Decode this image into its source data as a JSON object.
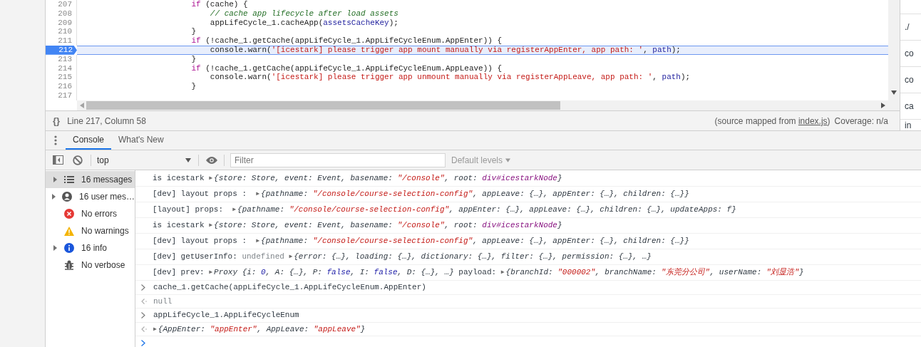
{
  "editor": {
    "lines": [
      {
        "number": "207",
        "selected": false,
        "tokens": [
          {
            "kind": "keyword",
            "text": "                        if"
          },
          {
            "kind": "plain",
            "text": " (cache) {"
          }
        ]
      },
      {
        "number": "208",
        "selected": false,
        "tokens": [
          {
            "kind": "comment",
            "text": "                            // cache app lifecycle after load assets"
          }
        ]
      },
      {
        "number": "209",
        "selected": false,
        "tokens": [
          {
            "kind": "plain",
            "text": "                            appLifeCycle_1.cacheApp("
          },
          {
            "kind": "variable",
            "text": "assetsCacheKey"
          },
          {
            "kind": "plain",
            "text": ");"
          }
        ]
      },
      {
        "number": "210",
        "selected": false,
        "tokens": [
          {
            "kind": "plain",
            "text": "                        }"
          }
        ]
      },
      {
        "number": "211",
        "selected": false,
        "tokens": [
          {
            "kind": "keyword",
            "text": "                        if"
          },
          {
            "kind": "plain",
            "text": " (!cache_1.getCache(appLifeCycle_1.AppLifeCycleEnum.AppEnter)) {"
          }
        ]
      },
      {
        "number": "212",
        "selected": true,
        "tokens": [
          {
            "kind": "plain",
            "text": "                            console.warn("
          },
          {
            "kind": "string",
            "text": "'[icestark] please trigger app mount manually via registerAppEnter, app path: '"
          },
          {
            "kind": "plain",
            "text": ", "
          },
          {
            "kind": "variable",
            "text": "path"
          },
          {
            "kind": "plain",
            "text": ");"
          }
        ]
      },
      {
        "number": "213",
        "selected": false,
        "tokens": [
          {
            "kind": "plain",
            "text": "                        }"
          }
        ]
      },
      {
        "number": "214",
        "selected": false,
        "tokens": [
          {
            "kind": "keyword",
            "text": "                        if"
          },
          {
            "kind": "plain",
            "text": " (!cache_1.getCache(appLifeCycle_1.AppLifeCycleEnum.AppLeave)) {"
          }
        ]
      },
      {
        "number": "215",
        "selected": false,
        "tokens": [
          {
            "kind": "plain",
            "text": "                            console.warn("
          },
          {
            "kind": "string",
            "text": "'[icestark] please trigger app unmount manually via registerAppLeave, app path: '"
          },
          {
            "kind": "plain",
            "text": ", "
          },
          {
            "kind": "variable",
            "text": "path"
          },
          {
            "kind": "plain",
            "text": ");"
          }
        ]
      },
      {
        "number": "216",
        "selected": false,
        "tokens": [
          {
            "kind": "plain",
            "text": "                        }"
          }
        ]
      },
      {
        "number": "217",
        "selected": false
      }
    ]
  },
  "right_panel": {
    "items": [
      "./",
      "co",
      "co",
      "ca",
      "in"
    ]
  },
  "status_bar": {
    "format_button": "{}",
    "cursor": "Line 217, Column 58",
    "source_prefix": "(source mapped from ",
    "source_link": "index.js",
    "source_suffix": ")",
    "coverage": "Coverage: n/a"
  },
  "drawer_tabs": [
    {
      "label": "Console",
      "selected": true
    },
    {
      "label": "What's New",
      "selected": false
    }
  ],
  "toolbar": {
    "context": "top",
    "filter_placeholder": "Filter",
    "levels": "Default levels"
  },
  "sidebar": {
    "items": [
      {
        "label": "16 messages",
        "kind": "list",
        "expandable": true,
        "selected": true
      },
      {
        "label": "16 user mes…",
        "kind": "user",
        "expandable": true,
        "selected": false
      },
      {
        "label": "No errors",
        "kind": "error",
        "expandable": false,
        "selected": false
      },
      {
        "label": "No warnings",
        "kind": "warning",
        "expandable": false,
        "selected": false
      },
      {
        "label": "16 info",
        "kind": "info",
        "expandable": true,
        "selected": false
      },
      {
        "label": "No verbose",
        "kind": "bug",
        "expandable": false,
        "selected": false
      }
    ]
  },
  "console": {
    "messages": [
      {
        "kind": "log",
        "tokens": [
          {
            "kind": "plain",
            "text": "is icestark "
          },
          {
            "kind": "expander",
            "text": "▶"
          },
          {
            "kind": "italic",
            "text": "{store: Store, event: Event, basename: "
          },
          {
            "kind": "string",
            "text": "\"/console\""
          },
          {
            "kind": "italic",
            "text": ", root: "
          },
          {
            "kind": "node",
            "text": "div#icestarkNode"
          },
          {
            "kind": "italic",
            "text": "}"
          }
        ]
      },
      {
        "kind": "log",
        "tokens": [
          {
            "kind": "plain",
            "text": "[dev] layout props :  "
          },
          {
            "kind": "expander",
            "text": "▶"
          },
          {
            "kind": "italic",
            "text": "{pathname: "
          },
          {
            "kind": "string",
            "text": "\"/console/course-selection-config\""
          },
          {
            "kind": "italic",
            "text": ", appLeave: {…}, appEnter: {…}, children: {…}}"
          }
        ]
      },
      {
        "kind": "log",
        "tokens": [
          {
            "kind": "plain",
            "text": "[layout] props:  "
          },
          {
            "kind": "expander",
            "text": "▶"
          },
          {
            "kind": "italic",
            "text": "{pathname: "
          },
          {
            "kind": "string",
            "text": "\"/console/course-selection-config\""
          },
          {
            "kind": "italic",
            "text": ", appEnter: {…}, appLeave: {…}, children: {…}, updateApps: f}"
          }
        ]
      },
      {
        "kind": "log",
        "tokens": [
          {
            "kind": "plain",
            "text": "is icestark "
          },
          {
            "kind": "expander",
            "text": "▶"
          },
          {
            "kind": "italic",
            "text": "{store: Store, event: Event, basename: "
          },
          {
            "kind": "string",
            "text": "\"/console\""
          },
          {
            "kind": "italic",
            "text": ", root: "
          },
          {
            "kind": "node",
            "text": "div#icestarkNode"
          },
          {
            "kind": "italic",
            "text": "}"
          }
        ]
      },
      {
        "kind": "log",
        "tokens": [
          {
            "kind": "plain",
            "text": "[dev] layout props :  "
          },
          {
            "kind": "expander",
            "text": "▶"
          },
          {
            "kind": "italic",
            "text": "{pathname: "
          },
          {
            "kind": "string",
            "text": "\"/console/course-selection-config\""
          },
          {
            "kind": "italic",
            "text": ", appLeave: {…}, appEnter: {…}, children: {…}}"
          }
        ]
      },
      {
        "kind": "log",
        "tokens": [
          {
            "kind": "plain",
            "text": "[dev] getUserInfo: "
          },
          {
            "kind": "muted",
            "text": "undefined "
          },
          {
            "kind": "expander",
            "text": "▶"
          },
          {
            "kind": "italic",
            "text": "{error: {…}, loading: {…}, dictionary: {…}, filter: {…}, permission: {…}, …}"
          }
        ]
      },
      {
        "kind": "log",
        "tokens": [
          {
            "kind": "plain",
            "text": "[dev] prev: "
          },
          {
            "kind": "expander",
            "text": "▶"
          },
          {
            "kind": "italic",
            "text": "Proxy {i: "
          },
          {
            "kind": "literal",
            "text": "0"
          },
          {
            "kind": "italic",
            "text": ", A: {…}, P: "
          },
          {
            "kind": "literal",
            "text": "false"
          },
          {
            "kind": "italic",
            "text": ", I: "
          },
          {
            "kind": "literal",
            "text": "false"
          },
          {
            "kind": "italic",
            "text": ", D: {…}, …}"
          },
          {
            "kind": "plain",
            "text": " payload: "
          },
          {
            "kind": "expander",
            "text": "▶"
          },
          {
            "kind": "italic",
            "text": "{branchId: "
          },
          {
            "kind": "string",
            "text": "\"000002\""
          },
          {
            "kind": "italic",
            "text": ", branchName: "
          },
          {
            "kind": "string",
            "text": "\"东莞分公司\""
          },
          {
            "kind": "italic",
            "text": ", userName: "
          },
          {
            "kind": "string",
            "text": "\"刘显浩\""
          },
          {
            "kind": "italic",
            "text": "}"
          }
        ]
      },
      {
        "kind": "input",
        "tokens": [
          {
            "kind": "plain",
            "text": "cache_1.getCache(appLifeCycle_1.AppLifeCycleEnum.AppEnter)"
          }
        ]
      },
      {
        "kind": "result",
        "tokens": [
          {
            "kind": "muted",
            "text": "null"
          }
        ]
      },
      {
        "kind": "input",
        "tokens": [
          {
            "kind": "plain",
            "text": "appLifeCycle_1.AppLifeCycleEnum"
          }
        ]
      },
      {
        "kind": "result",
        "tokens": [
          {
            "kind": "expander",
            "text": "▶"
          },
          {
            "kind": "italic",
            "text": "{AppEnter: "
          },
          {
            "kind": "string",
            "text": "\"appEnter\""
          },
          {
            "kind": "italic",
            "text": ", AppLeave: "
          },
          {
            "kind": "string",
            "text": "\"appLeave\""
          },
          {
            "kind": "italic",
            "text": "}"
          }
        ]
      },
      {
        "kind": "prompt"
      }
    ]
  }
}
